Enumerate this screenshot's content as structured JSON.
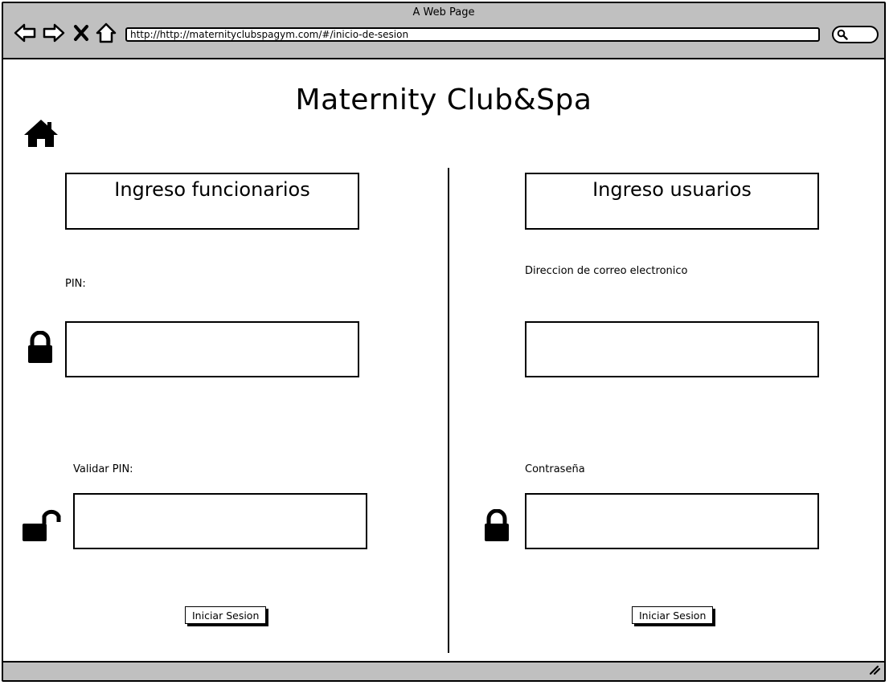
{
  "window": {
    "title": "A Web Page",
    "url": "http://http://maternityclubspagym.com/#/inicio-de-sesion"
  },
  "icons": {
    "back": "arrow-left-icon",
    "forward": "arrow-right-icon",
    "close": "close-icon",
    "home_nav": "home-icon",
    "search": "search-icon",
    "home": "home-icon",
    "lock": "lock-icon",
    "unlock": "unlock-icon",
    "resize": "resize-grip-icon"
  },
  "page": {
    "title": "Maternity Club&Spa"
  },
  "staff": {
    "header": "Ingreso funcionarios",
    "pin_label": "PIN:",
    "pin_value": "",
    "validate_label": "Validar PIN:",
    "validate_value": "",
    "submit_label": "Iniciar Sesion"
  },
  "users": {
    "header": "Ingreso usuarios",
    "email_label": "Direccion de correo electronico",
    "email_value": "",
    "password_label": "Contraseña",
    "password_value": "",
    "submit_label": "Iniciar Sesion"
  },
  "colors": {
    "chrome": "#c0c0c0",
    "ink": "#000000",
    "background": "#ffffff"
  }
}
